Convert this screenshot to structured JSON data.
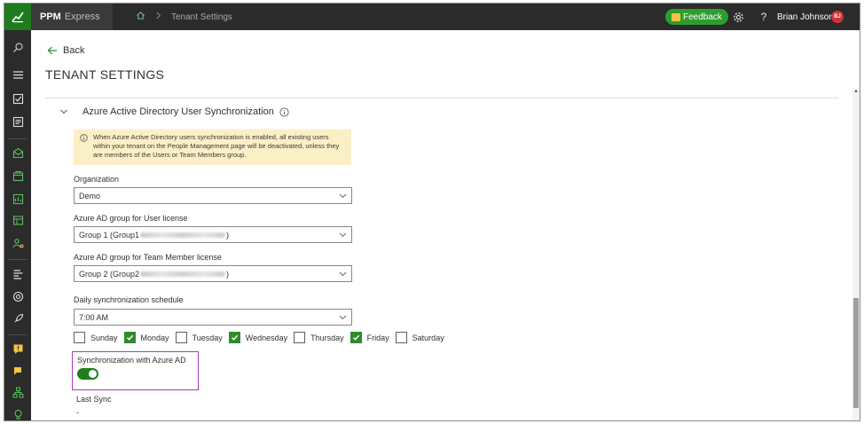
{
  "topbar": {
    "app_name_bold": "PPM",
    "app_name_light": "Express",
    "breadcrumb_current": "Tenant Settings",
    "feedback_label": "Feedback",
    "help_label": "?",
    "user_name": "Brian Johnson",
    "user_initials": "BJ"
  },
  "page": {
    "back_label": "Back",
    "title": "TENANT SETTINGS"
  },
  "section": {
    "title": "Azure Active Directory User Synchronization",
    "warning_line1": "When Azure Active Directory users synchronization is enabled, all existing users",
    "warning_line2": "within your tenant on the People Management page will be deactivated, unless they",
    "warning_line3": "are members of the Users or Team Members group."
  },
  "form": {
    "organization_label": "Organization",
    "organization_value": "Demo",
    "user_group_label": "Azure AD group for User license",
    "user_group_prefix": "Group 1 (Group1",
    "user_group_suffix": ")",
    "member_group_label": "Azure AD group for Team Member license",
    "member_group_prefix": "Group 2 (Group2",
    "member_group_suffix": ")",
    "schedule_label": "Daily synchronization schedule",
    "schedule_value": "7:00 AM",
    "days": [
      {
        "label": "Sunday",
        "checked": false
      },
      {
        "label": "Monday",
        "checked": true
      },
      {
        "label": "Tuesday",
        "checked": false
      },
      {
        "label": "Wednesday",
        "checked": true
      },
      {
        "label": "Thursday",
        "checked": false
      },
      {
        "label": "Friday",
        "checked": true
      },
      {
        "label": "Saturday",
        "checked": false
      }
    ],
    "sync_toggle_label": "Synchronization with Azure AD",
    "sync_toggle_on": true,
    "last_sync_label": "Last Sync",
    "last_sync_value": "-"
  },
  "colors": {
    "accent_green": "#2e8b2e",
    "highlight_border": "#a23fb0",
    "warning_bg": "#fbefc5",
    "topbar_bg": "#2b2b2b"
  },
  "icons": {
    "rail": [
      "search-icon",
      "menu-icon",
      "checkbox-icon",
      "report-icon",
      "inbox-icon",
      "portfolio-icon",
      "board-icon",
      "resource-icon",
      "people-icon",
      "roadmap-icon",
      "rocket-target-icon",
      "rocket-icon",
      "alert-icon",
      "chat-icon",
      "org-icon",
      "bulb-icon"
    ]
  }
}
